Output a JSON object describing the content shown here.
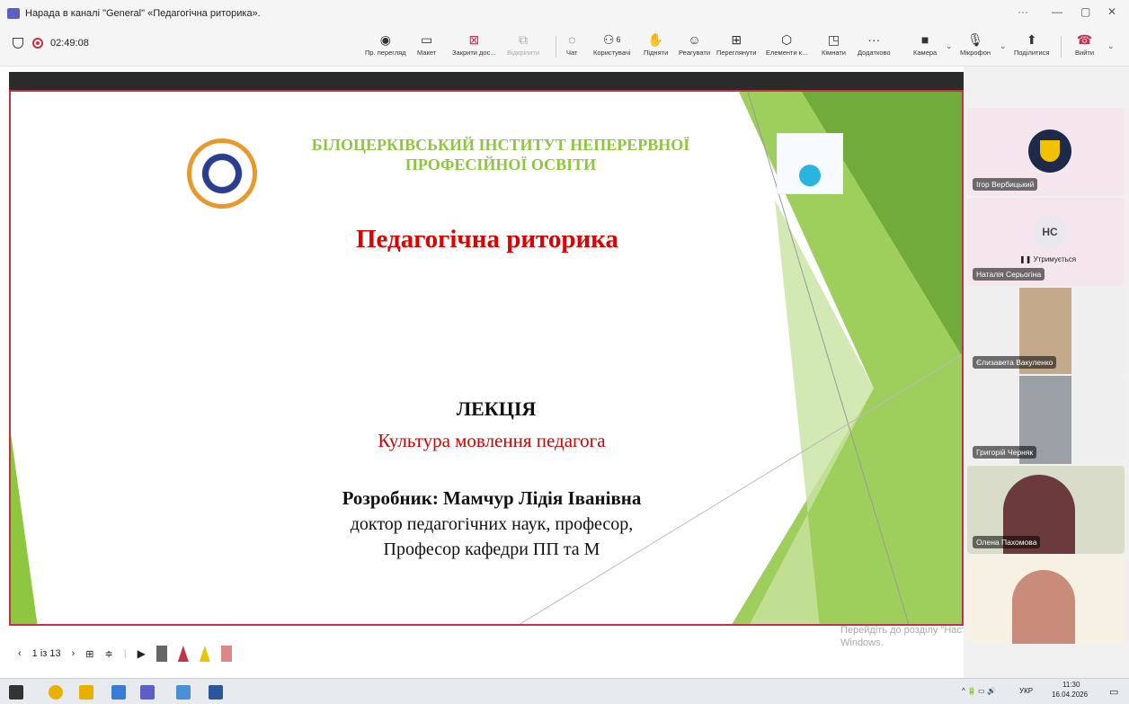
{
  "window": {
    "title": "Нарада в каналі \"General\" «Педагогічна риторика»."
  },
  "toolbar": {
    "timer": "02:49:08",
    "items": [
      {
        "label": "Пр. перегляд"
      },
      {
        "label": "Макет"
      },
      {
        "label": "Закрити дос..."
      },
      {
        "label": "Відкріпити"
      },
      {
        "label": "Чат"
      },
      {
        "label": "Користувачі",
        "count": "6"
      },
      {
        "label": "Підняти"
      },
      {
        "label": "Реагувати"
      },
      {
        "label": "Переглянути"
      },
      {
        "label": "Елементи к..."
      },
      {
        "label": "Кімнати"
      },
      {
        "label": "Додатково"
      },
      {
        "label": "Камера"
      },
      {
        "label": "Мікрофон"
      },
      {
        "label": "Поділитися"
      },
      {
        "label": "Вийти"
      }
    ]
  },
  "slide": {
    "institution": "БІЛОЦЕРКІВСЬКИЙ ІНСТИТУТ НЕПЕРЕРВНОЇ ПРОФЕСІЙНОЇ ОСВІТИ",
    "title": "Педагогічна риторика",
    "lecture": "ЛЕКЦІЯ",
    "subtitle": "Культура мовлення педагога",
    "author": "Розробник: Мамчур Лідія Іванівна",
    "position1": "доктор педагогічних наук, професор,",
    "position2": "Професор кафедри ПП та М"
  },
  "presenter_controls": {
    "page": "1 із 13"
  },
  "watermark": {
    "line1": "Перейдіть до розділу \"Настройки\", щоб активувати",
    "line2": "Windows."
  },
  "participants": [
    {
      "name": "Ігор Вербицький"
    },
    {
      "name": "Наталія Серьогіна",
      "initials": "НС",
      "status": "Утримується"
    },
    {
      "name": "Єлизавета Вакуленко"
    },
    {
      "name": "Григорій Черняк"
    },
    {
      "name": "Олена Пахомова"
    },
    {
      "name": ""
    }
  ],
  "taskbar": {
    "lang": "УКР",
    "time": "11:30",
    "date": "16.04.2026"
  }
}
